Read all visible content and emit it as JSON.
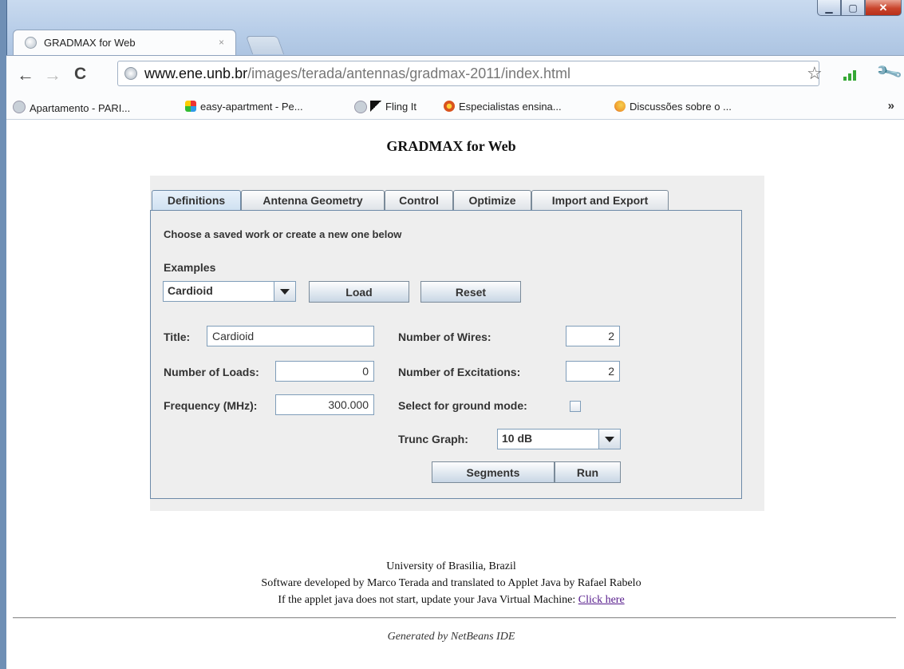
{
  "browser": {
    "tab_title": "GRADMAX for Web",
    "tab_close": "×",
    "url_host": "www.ene.unb.br",
    "url_path": "/images/terada/antennas/gradmax-2011/index.html",
    "back": "←",
    "forward": "→",
    "reload": "C",
    "star": "☆",
    "wrench": "🔧",
    "overflow": "»"
  },
  "bookmarks": [
    {
      "label": "Apartamento - PARI...",
      "icon": "globe-icon",
      "color": "#b8c2cc"
    },
    {
      "label": "easy-apartment - Pe...",
      "icon": "colorful-icon",
      "color": "#2e9be6"
    },
    {
      "label": "",
      "icon": "globe-icon",
      "color": "#b8c2cc"
    },
    {
      "label": "Fling It",
      "icon": "fling-icon",
      "color": "#111111"
    },
    {
      "label": "Especialistas ensina...",
      "icon": "badge-icon",
      "color": "#d9531e"
    },
    {
      "label": "Discussões sobre o ...",
      "icon": "flame-icon",
      "color": "#f0a030"
    }
  ],
  "page": {
    "title": "GRADMAX for Web",
    "footer_line1": "University of Brasilia, Brazil",
    "footer_line2": "Software developed by Marco Terada and translated to Applet Java by Rafael Rabelo",
    "footer_line3": "If the applet java does not start, update your Java Virtual Machine:",
    "footer_link": "Click here",
    "generated": "Generated by NetBeans IDE"
  },
  "applet": {
    "tabs": [
      "Definitions",
      "Antenna Geometry",
      "Control",
      "Optimize",
      "Import and Export"
    ],
    "intro": "Choose a saved work or create a new one below",
    "examples_label": "Examples",
    "examples_value": "Cardioid",
    "load_label": "Load",
    "reset_label": "Reset",
    "title_label": "Title:",
    "title_value": "Cardioid",
    "loads_label": "Number of Loads:",
    "loads_value": "0",
    "freq_label": "Frequency (MHz):",
    "freq_value": "300.000",
    "wires_label": "Number of Wires:",
    "wires_value": "2",
    "excitations_label": "Number of Excitations:",
    "excitations_value": "2",
    "ground_label": "Select for ground mode:",
    "ground_checked": false,
    "trunc_label": "Trunc Graph:",
    "trunc_value": "10 dB",
    "segments_label": "Segments",
    "run_label": "Run"
  }
}
